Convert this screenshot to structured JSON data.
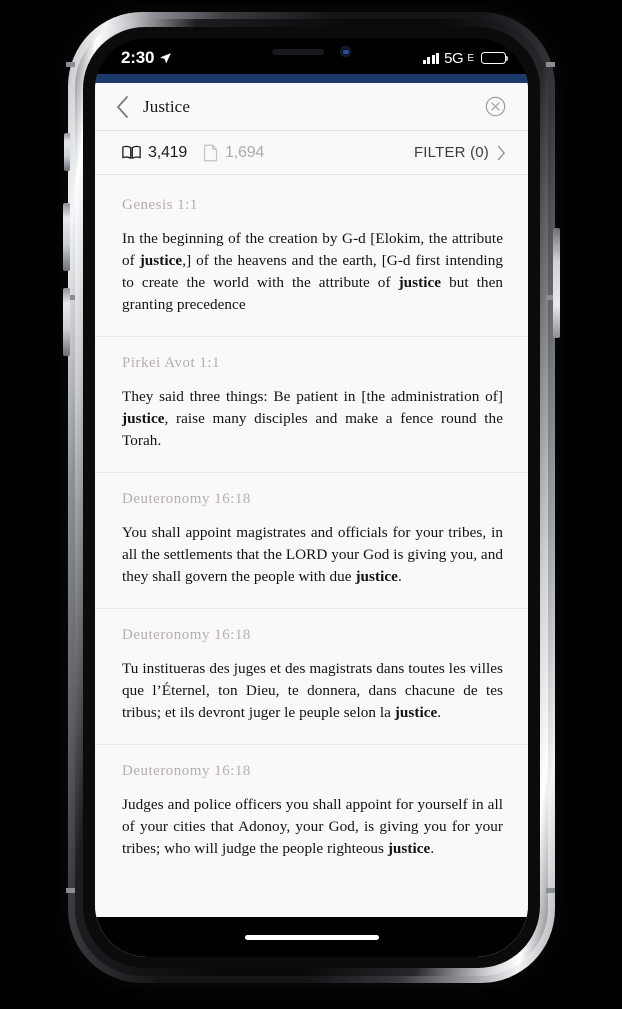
{
  "status_bar": {
    "time": "2:30",
    "location_icon": "location-arrow-icon",
    "network": "5G",
    "network_suffix": "E",
    "signal_icon": "signal-bars-icon",
    "battery_icon": "battery-icon"
  },
  "nav": {
    "back_icon": "chevron-left-icon",
    "title": "Justice",
    "close_icon": "close-circle-icon"
  },
  "counts": {
    "book_icon": "open-book-icon",
    "book_count": "3,419",
    "doc_icon": "document-icon",
    "doc_count": "1,694",
    "filter_label": "FILTER (0)",
    "filter_chevron_icon": "chevron-right-icon"
  },
  "theme": {
    "accent": "#1b3a6b",
    "page_bg": "#faf9f7",
    "muted_text": "#b3b0ab",
    "body_text": "#121212"
  },
  "results": [
    {
      "ref": "Genesis 1:1",
      "parts": [
        {
          "t": "In the beginning of the creation by G-d [Elokim, the attribute of ",
          "b": false
        },
        {
          "t": "justice",
          "b": true
        },
        {
          "t": ",] of the heavens and the earth, [G-d first intending to create the world with the attribute of ",
          "b": false
        },
        {
          "t": "justice",
          "b": true
        },
        {
          "t": " but then granting precedence",
          "b": false
        }
      ]
    },
    {
      "ref": "Pirkei Avot 1:1",
      "parts": [
        {
          "t": "They said three things:  Be patient in [the administration of] ",
          "b": false
        },
        {
          "t": "justice",
          "b": true
        },
        {
          "t": ", raise many disciples and make a fence round the Torah.",
          "b": false
        }
      ]
    },
    {
      "ref": "Deuteronomy 16:18",
      "parts": [
        {
          "t": "You shall appoint magistrates and officials for your tribes, in all the settlements that the LORD your God is giving you, and they shall govern the people with due ",
          "b": false
        },
        {
          "t": "justice",
          "b": true
        },
        {
          "t": ".",
          "b": false
        }
      ]
    },
    {
      "ref": "Deuteronomy 16:18",
      "parts": [
        {
          "t": "Tu institueras des juges et des magistrats dans toutes les villes que l’Éternel, ton Dieu, te donnera, dans chacune de tes tribus; et ils devront juger le peuple selon la ",
          "b": false
        },
        {
          "t": "justice",
          "b": true
        },
        {
          "t": ".",
          "b": false
        }
      ]
    },
    {
      "ref": "Deuteronomy 16:18",
      "parts": [
        {
          "t": "Judges and police officers you shall appoint for yourself in all of your cities that Adonoy, your God, is giving you for your tribes; who will judge the people righteous ",
          "b": false
        },
        {
          "t": "justice",
          "b": true
        },
        {
          "t": ".",
          "b": false
        }
      ]
    }
  ]
}
